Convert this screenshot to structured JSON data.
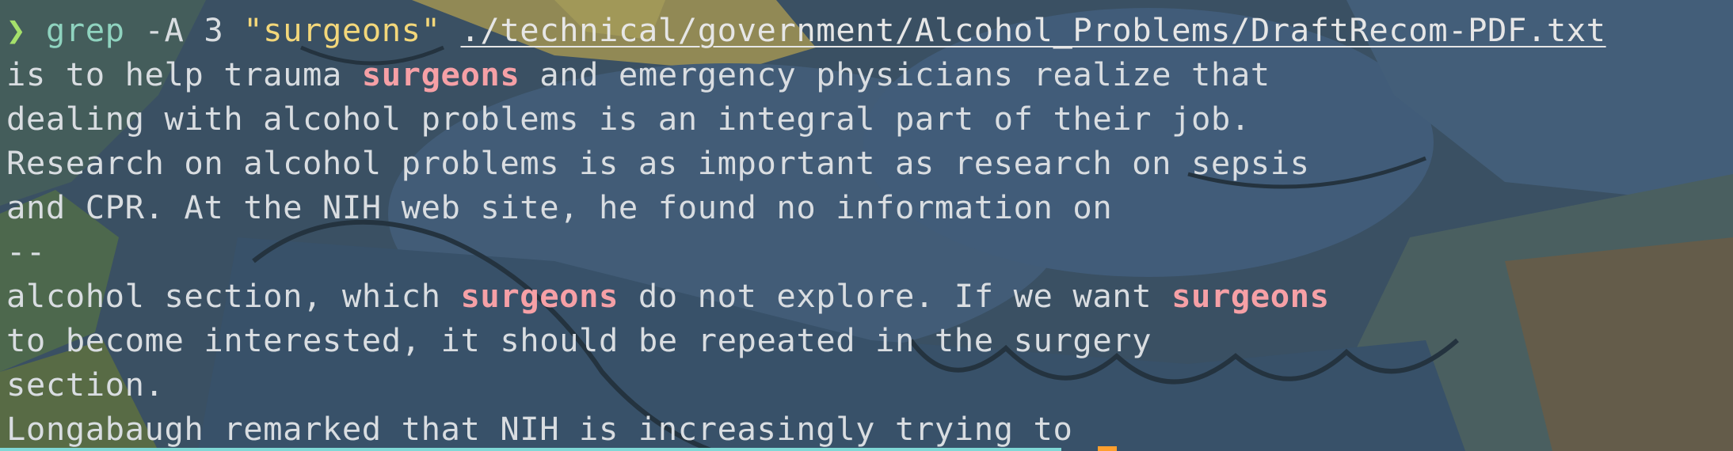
{
  "theme": {
    "background": "#3f5a70",
    "text": "#d9dde1",
    "prompt": "#a5e06b",
    "command": "#8fd3bf",
    "string": "#f3d77a",
    "match": "#f6a0a6",
    "cursor_strip": "#7fd8d6",
    "cursor": "#ff9f2e"
  },
  "prompt": {
    "glyph": "❯",
    "command": "grep",
    "flags": "-A 3",
    "pattern": "\"surgeons\"",
    "path": "./technical/government/Alcohol_Problems/DraftRecom-PDF.txt"
  },
  "output": {
    "line1": {
      "before": "is to help trauma ",
      "match": "surgeons",
      "after": " and emergency physicians realize that"
    },
    "line2": "dealing with alcohol problems is an integral part of their job.",
    "line3": "Research on alcohol problems is as important as research on sepsis",
    "line4": "and CPR. At the NIH web site, he found no information on",
    "separator": "--",
    "line6": {
      "before": "alcohol section, which ",
      "match1": "surgeons",
      "middle": " do not explore. If we want ",
      "match2": "surgeons"
    },
    "line7": "to become interested, it should be repeated in the surgery",
    "line8": "section.",
    "line9": "Longabaugh remarked that NIH is increasingly trying to"
  }
}
